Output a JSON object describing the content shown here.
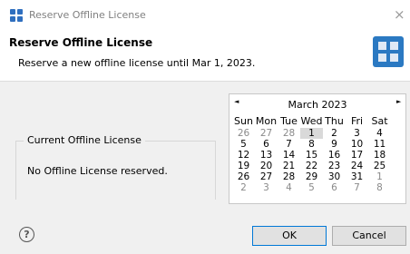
{
  "window": {
    "title": "Reserve Offline License",
    "close_glyph": "×",
    "icon": "app-grid-icon"
  },
  "header": {
    "title": "Reserve Offline License",
    "description": "Reserve a new offline license until Mar 1, 2023.",
    "icon": "license-grid-icon"
  },
  "current_license": {
    "label": "Current Offline License",
    "value": "No Offline License reserved."
  },
  "calendar": {
    "prev_glyph": "◄",
    "next_glyph": "►",
    "month_label": "March 2023",
    "weekdays": [
      "Sun",
      "Mon",
      "Tue",
      "Wed",
      "Thu",
      "Fri",
      "Sat"
    ],
    "weeks": [
      [
        "26",
        "27",
        "28",
        "1",
        "2",
        "3",
        "4"
      ],
      [
        "5",
        "6",
        "7",
        "8",
        "9",
        "10",
        "11"
      ],
      [
        "12",
        "13",
        "14",
        "15",
        "16",
        "17",
        "18"
      ],
      [
        "19",
        "20",
        "21",
        "22",
        "23",
        "24",
        "25"
      ],
      [
        "26",
        "27",
        "28",
        "29",
        "30",
        "31",
        "1"
      ],
      [
        "2",
        "3",
        "4",
        "5",
        "6",
        "7",
        "8"
      ]
    ],
    "selected_date": "1",
    "other_month_text_color": "#8a8a8a",
    "selected_background": "#d9d9d9"
  },
  "footer": {
    "help_glyph": "?",
    "ok_label": "OK",
    "cancel_label": "Cancel"
  },
  "colors": {
    "accent": "#2b79c2",
    "default_button_border": "#0078d7"
  }
}
